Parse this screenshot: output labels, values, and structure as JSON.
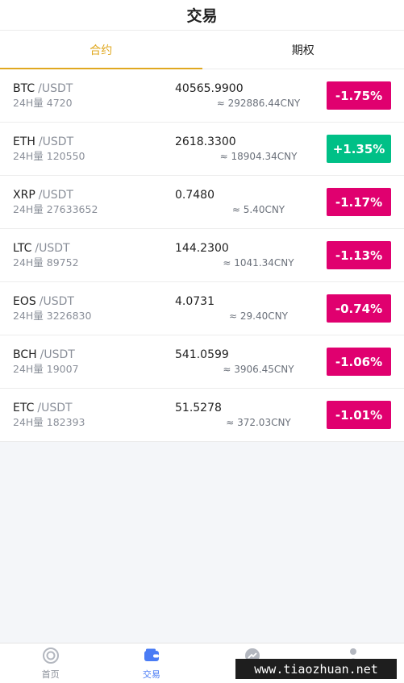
{
  "header": {
    "title": "交易"
  },
  "tabs": [
    {
      "label": "合约",
      "active": true
    },
    {
      "label": "期权",
      "active": false
    }
  ],
  "colors": {
    "accent": "#e0a820",
    "down": "#e0006f",
    "up": "#00c087",
    "nav_active": "#4a7cf5"
  },
  "markets": [
    {
      "base": "BTC",
      "quote": "/USDT",
      "volume": "24H量 4720",
      "price": "40565.9900",
      "cny": "≈ 292886.44CNY",
      "change": "-1.75%",
      "direction": "down"
    },
    {
      "base": "ETH",
      "quote": "/USDT",
      "volume": "24H量 120550",
      "price": "2618.3300",
      "cny": "≈ 18904.34CNY",
      "change": "+1.35%",
      "direction": "up"
    },
    {
      "base": "XRP",
      "quote": "/USDT",
      "volume": "24H量 27633652",
      "price": "0.7480",
      "cny": "≈ 5.40CNY",
      "change": "-1.17%",
      "direction": "down"
    },
    {
      "base": "LTC",
      "quote": "/USDT",
      "volume": "24H量 89752",
      "price": "144.2300",
      "cny": "≈ 1041.34CNY",
      "change": "-1.13%",
      "direction": "down"
    },
    {
      "base": "EOS",
      "quote": "/USDT",
      "volume": "24H量 3226830",
      "price": "4.0731",
      "cny": "≈ 29.40CNY",
      "change": "-0.74%",
      "direction": "down"
    },
    {
      "base": "BCH",
      "quote": "/USDT",
      "volume": "24H量 19007",
      "price": "541.0599",
      "cny": "≈ 3906.45CNY",
      "change": "-1.06%",
      "direction": "down"
    },
    {
      "base": "ETC",
      "quote": "/USDT",
      "volume": "24H量 182393",
      "price": "51.5278",
      "cny": "≈ 372.03CNY",
      "change": "-1.01%",
      "direction": "down"
    }
  ],
  "tabbar": [
    {
      "label": "首页",
      "icon": "home-icon",
      "active": false
    },
    {
      "label": "交易",
      "icon": "wallet-icon",
      "active": true
    },
    {
      "label": "",
      "icon": "trend-icon",
      "active": false
    },
    {
      "label": "",
      "icon": "user-icon",
      "active": false
    }
  ],
  "watermark": "www.tiaozhuan.net"
}
